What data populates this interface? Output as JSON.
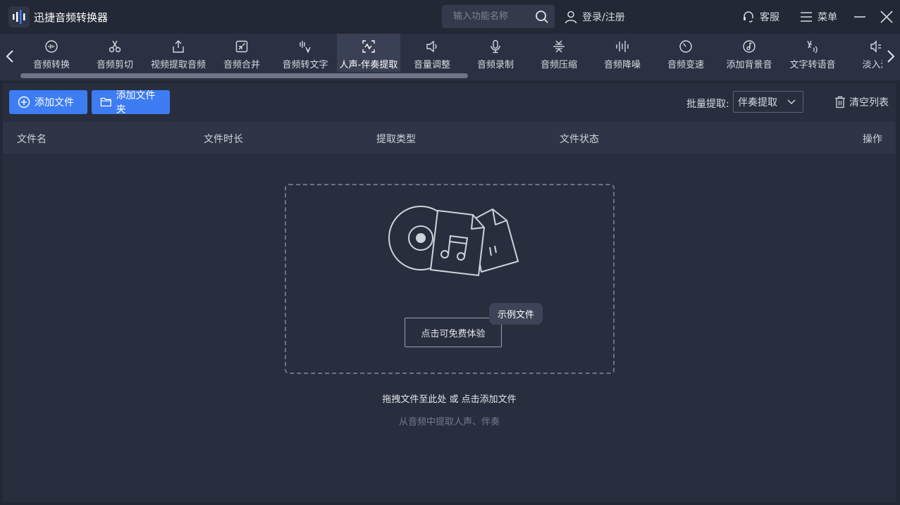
{
  "app": {
    "title": "迅捷音频转换器"
  },
  "search": {
    "placeholder": "输入功能名称"
  },
  "header": {
    "login_label": "登录/注册",
    "service_label": "客服",
    "menu_label": "菜单"
  },
  "tools": [
    {
      "label": "音频转换",
      "icon": "audio-convert-icon"
    },
    {
      "label": "音频剪切",
      "icon": "scissors-icon"
    },
    {
      "label": "视频提取音频",
      "icon": "upload-share-icon"
    },
    {
      "label": "音频合并",
      "icon": "merge-arrows-icon"
    },
    {
      "label": "音频转文字",
      "icon": "audio-text-icon"
    },
    {
      "label": "人声-伴奏提取",
      "icon": "voice-extract-icon",
      "active": true
    },
    {
      "label": "音量调整",
      "icon": "speaker-icon"
    },
    {
      "label": "音频录制",
      "icon": "microphone-icon"
    },
    {
      "label": "音频压缩",
      "icon": "compress-icon"
    },
    {
      "label": "音频降噪",
      "icon": "waveform-icon"
    },
    {
      "label": "音频变速",
      "icon": "speedometer-icon"
    },
    {
      "label": "添加背景音",
      "icon": "music-note-icon"
    },
    {
      "label": "文字转语音",
      "icon": "text-speech-icon"
    },
    {
      "label": "淡入淡",
      "icon": "fade-icon"
    }
  ],
  "actions": {
    "add_file": "添加文件",
    "add_folder": "添加文件夹",
    "batch_label": "批量提取:",
    "batch_value": "伴奏提取",
    "clear_list": "清空列表"
  },
  "table": {
    "columns": [
      "文件名",
      "文件时长",
      "提取类型",
      "文件状态",
      "操作"
    ]
  },
  "dropzone": {
    "trial_button": "点击可免费体验",
    "sample_tag": "示例文件",
    "hint": "拖拽文件至此处 或 点击添加文件",
    "sub_hint": "从音频中提取人声、伴奏"
  },
  "colors": {
    "accent": "#3d7cf2",
    "background": "#232836",
    "panel": "#292e3e"
  }
}
